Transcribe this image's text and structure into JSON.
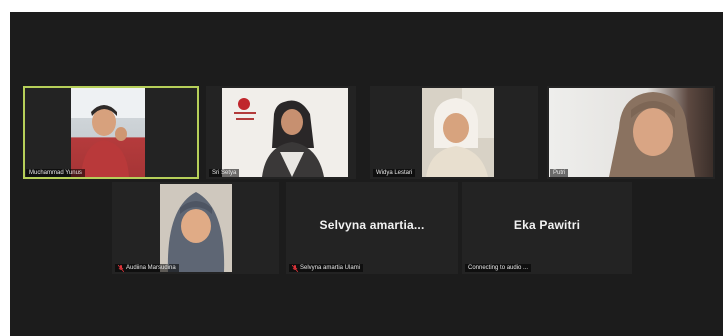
{
  "meeting": {
    "participants": [
      {
        "name": "Muchammad Yunus",
        "video": true,
        "active_speaker": true,
        "muted": false
      },
      {
        "name": "Sri Setya",
        "video": true,
        "muted": false
      },
      {
        "name": "Widya Lestari",
        "video": true,
        "muted": false
      },
      {
        "name": "Putri",
        "video": true,
        "muted": false
      },
      {
        "name": "Audiina Marsudina",
        "video": true,
        "muted": true
      },
      {
        "name": "Selvyna amartia Ulami",
        "display_name": "Selvyna amartia...",
        "video": false,
        "muted": true
      },
      {
        "name": "Eka Pawitri",
        "display_name": "Eka Pawitri",
        "video": false,
        "status": "Connecting to audio ..."
      }
    ]
  },
  "colors": {
    "background": "#1c1c1c",
    "tile": "#232323",
    "active_speaker_border": "#b6cf59",
    "muted_icon": "#e0343a"
  },
  "icons": {
    "muted": "microphone-muted-icon"
  }
}
